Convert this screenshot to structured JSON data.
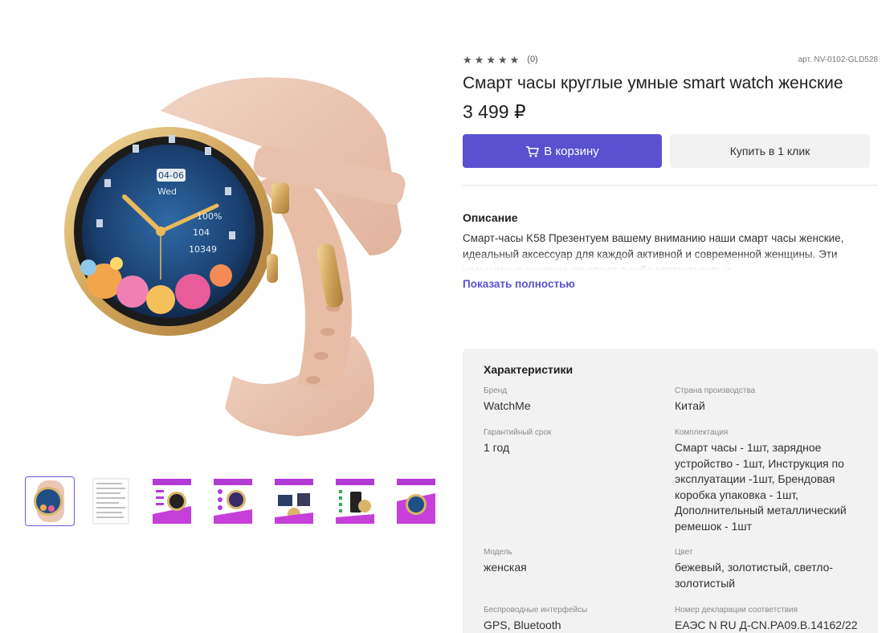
{
  "product": {
    "rating_stars": [
      "★",
      "★",
      "★",
      "★",
      "★"
    ],
    "rating_count": "(0)",
    "sku": "арт. NV-0102-GLD528",
    "title": "Смарт часы круглые умные smart watch женские",
    "price": "3 499 ₽"
  },
  "actions": {
    "cart_label": "В корзину",
    "one_click_label": "Купить в 1 клик"
  },
  "watch_face": {
    "date": "04-06",
    "day": "Wed",
    "battery": "100%",
    "heart_rate": "104",
    "steps": "10349"
  },
  "description": {
    "title": "Описание",
    "text": "Смарт-часы K58 Презентуем вашему вниманию наши смарт часы женские, идеальный аксессуар для каждой активной и современной женщины. Эти часы умные женские сочетают в себе элегантность и",
    "show_more": "Показать полностью"
  },
  "specs": {
    "title": "Характеристики",
    "left": [
      {
        "label": "Бренд",
        "value": "WatchMe"
      },
      {
        "label": "Гарантийный срок",
        "value": "1 год"
      },
      {
        "label": "Модель",
        "value": "женская"
      },
      {
        "label": "Беспроводные интерфейсы",
        "value": "GPS, Bluetooth"
      }
    ],
    "right": [
      {
        "label": "Страна производства",
        "value": "Китай"
      },
      {
        "label": "Комплектация",
        "value": "Смарт часы - 1шт, зарядное устройство - 1шт, Инструкция по эксплуатации -1шт, Брендовая коробка упаковка - 1шт, Дополнительный металлический ремешок - 1шт"
      },
      {
        "label": "Цвет",
        "value": "бежевый, золотистый, светло-золотистый"
      },
      {
        "label": "Номер декларации соответствия",
        "value": "ЕАЭС N RU Д-CN.PA09.B.14162/22"
      }
    ]
  },
  "colors": {
    "accent": "#5a50d0",
    "strap": "#ecc7b3",
    "gold": "#d9b46a",
    "dial": "#1f4f86"
  },
  "icons": {
    "cart": "cart-icon",
    "star": "star-icon"
  }
}
